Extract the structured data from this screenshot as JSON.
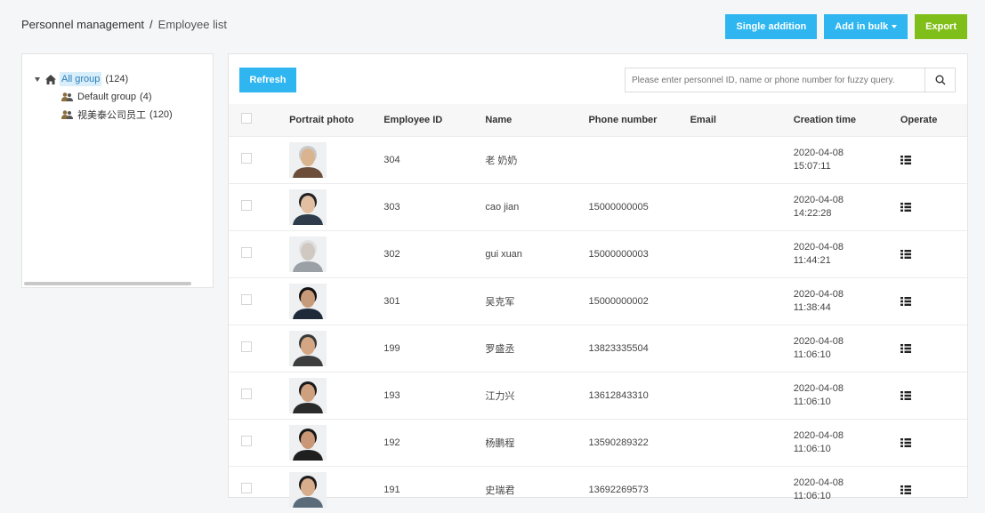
{
  "breadcrumb": {
    "parent": "Personnel management",
    "separator": "/",
    "current": "Employee list"
  },
  "header_buttons": {
    "single": "Single addition",
    "bulk": "Add in bulk",
    "export": "Export"
  },
  "tree": {
    "root": {
      "label": "All group",
      "count": "(124)"
    },
    "children": [
      {
        "label": "Default group",
        "count": "(4)"
      },
      {
        "label": "视美泰公司员工",
        "count": "(120)"
      }
    ]
  },
  "toolbar": {
    "refresh": "Refresh",
    "search_placeholder": "Please enter personnel ID, name or phone number for fuzzy query."
  },
  "table": {
    "headers": [
      "Portrait photo",
      "Employee ID",
      "Name",
      "Phone number",
      "Email",
      "Creation time",
      "Operate"
    ],
    "rows": [
      {
        "id": "304",
        "name": "老 奶奶",
        "phone": "",
        "email": "",
        "date": "2020-04-08",
        "time": "15:07:11"
      },
      {
        "id": "303",
        "name": "cao jian",
        "phone": "15000000005",
        "email": "",
        "date": "2020-04-08",
        "time": "14:22:28"
      },
      {
        "id": "302",
        "name": "gui xuan",
        "phone": "15000000003",
        "email": "",
        "date": "2020-04-08",
        "time": "11:44:21"
      },
      {
        "id": "301",
        "name": "吴克军",
        "phone": "15000000002",
        "email": "",
        "date": "2020-04-08",
        "time": "11:38:44"
      },
      {
        "id": "199",
        "name": "罗盛丞",
        "phone": "13823335504",
        "email": "",
        "date": "2020-04-08",
        "time": "11:06:10"
      },
      {
        "id": "193",
        "name": "江力兴",
        "phone": "13612843310",
        "email": "",
        "date": "2020-04-08",
        "time": "11:06:10"
      },
      {
        "id": "192",
        "name": "杨鹏程",
        "phone": "13590289322",
        "email": "",
        "date": "2020-04-08",
        "time": "11:06:10"
      },
      {
        "id": "191",
        "name": "史瑞君",
        "phone": "13692269573",
        "email": "",
        "date": "2020-04-08",
        "time": "11:06:10"
      }
    ]
  },
  "colors": {
    "accent_blue": "#2fb6f0",
    "export_green": "#80bf1a",
    "selected_bg": "#d9eefb"
  }
}
